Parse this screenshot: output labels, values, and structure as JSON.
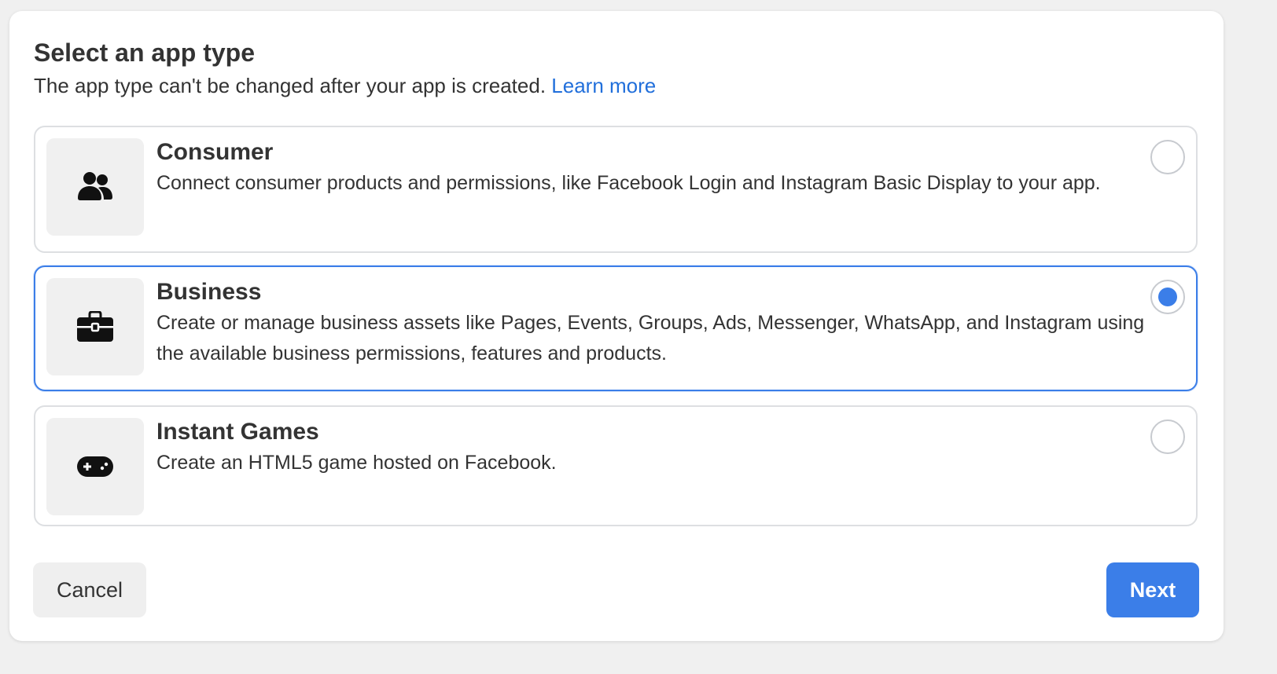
{
  "dialog": {
    "title": "Select an app type",
    "subtitle": "The app type can't be changed after your app is created.",
    "learn_more": "Learn more"
  },
  "options": [
    {
      "title": "Consumer",
      "description": "Connect consumer products and permissions, like Facebook Login and Instagram Basic Display to your app.",
      "icon": "people-icon",
      "selected": false
    },
    {
      "title": "Business",
      "description": "Create or manage business assets like Pages, Events, Groups, Ads, Messenger, WhatsApp, and Instagram using the available business permissions, features and products.",
      "icon": "briefcase-icon",
      "selected": true
    },
    {
      "title": "Instant Games",
      "description": "Create an HTML5 game hosted on Facebook.",
      "icon": "gamepad-icon",
      "selected": false
    }
  ],
  "buttons": {
    "cancel": "Cancel",
    "next": "Next"
  },
  "colors": {
    "accent": "#3b7ee8",
    "link": "#216fdb"
  }
}
